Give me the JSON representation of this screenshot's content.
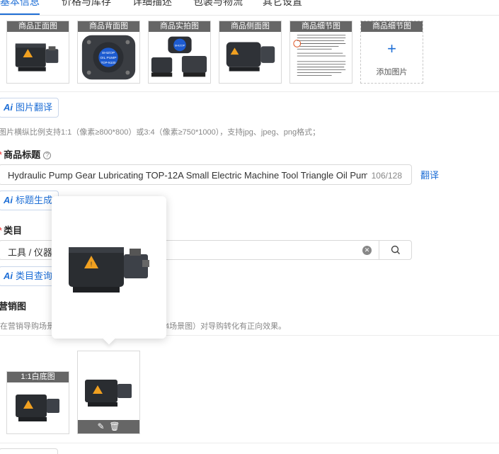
{
  "tabs": [
    {
      "label": "基本信息",
      "active": true
    },
    {
      "label": "价格与库存",
      "active": false
    },
    {
      "label": "详细描述",
      "active": false
    },
    {
      "label": "包装与物流",
      "active": false
    },
    {
      "label": "其它设置",
      "active": false
    }
  ],
  "product_images": [
    {
      "caption": "商品正面图"
    },
    {
      "caption": "商品背面图",
      "pump_label_1": "SHIZOP",
      "pump_label_2": "OIL PUMP",
      "pump_label_3": "TOP-N100"
    },
    {
      "caption": "商品实拍图",
      "pump_label_1": "SHIZOP"
    },
    {
      "caption": "商品侧面图"
    },
    {
      "caption": "商品细节图"
    }
  ],
  "add_image": {
    "caption": "商品细节图",
    "label": "添加图片"
  },
  "image_translate_button": {
    "ai": "Ai",
    "label": "图片翻译"
  },
  "image_hint": "图片横纵比例支持1:1（像素≥800*800）或3:4（像素≥750*1000），支持jpg、jpeg、png格式；",
  "title_field": {
    "label": "商品标题",
    "value": "Hydraulic Pump Gear Lubricating  TOP-12A Small Electric Machine Tool Triangle  Oil Pump Motor",
    "count": "106/128",
    "translate": "翻译"
  },
  "title_generate_button": {
    "ai": "Ai",
    "label": "标题生成"
  },
  "category_field": {
    "label": "类目",
    "value": "工具 / 仪器"
  },
  "category_query_button": {
    "ai": "Ai",
    "label": "类目查询"
  },
  "marketing": {
    "label": "营销图",
    "hint_left": "在营销导购场景",
    "hint_right": "4场景图）对导购转化有正向效果。",
    "white_bg_caption": "1:1白底图"
  },
  "colors": {
    "accent": "#1f6fd6",
    "caption_bg": "#666666"
  },
  "icons": [
    "help-icon",
    "plus-icon",
    "clear-icon",
    "search-icon",
    "edit-icon",
    "delete-icon"
  ]
}
